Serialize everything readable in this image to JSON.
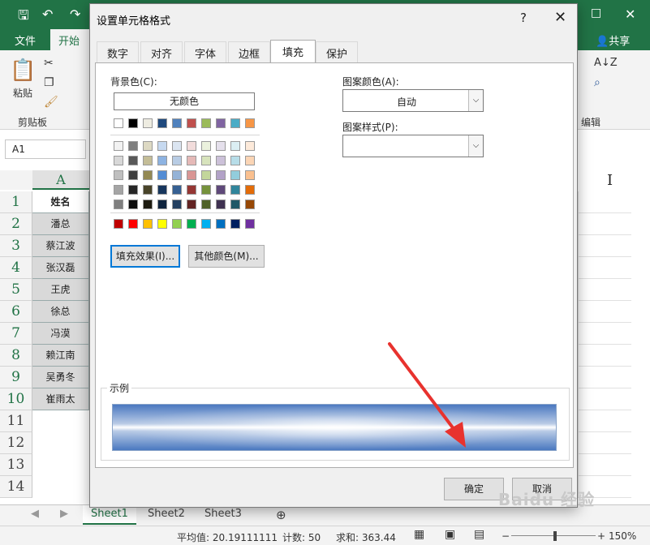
{
  "excel": {
    "ribbon_tabs": [
      "文件",
      "开始"
    ],
    "share_label": "共享",
    "clipboard": {
      "paste_label": "粘贴",
      "group_label": "剪贴板"
    },
    "edit_group_label": "编辑",
    "namebox_value": "A1",
    "column_a_label": "A",
    "col_i_label": "I",
    "rows": [
      "1",
      "2",
      "3",
      "4",
      "5",
      "6",
      "7",
      "8",
      "9",
      "10",
      "11",
      "12",
      "13",
      "14"
    ],
    "names": [
      "姓名",
      "潘总",
      "蔡江波",
      "张汉磊",
      "王虎",
      "徐总",
      "冯漠",
      "赖江南",
      "吴勇冬",
      "崔雨太"
    ],
    "sheets": [
      "Sheet1",
      "Sheet2",
      "Sheet3"
    ],
    "status": {
      "average": "平均值: 20.19111111",
      "count": "计数: 50",
      "sum": "求和: 363.44",
      "zoom": "150%"
    }
  },
  "dialog": {
    "title": "设置单元格格式",
    "help": "?",
    "tabs": [
      "数字",
      "对齐",
      "字体",
      "边框",
      "填充",
      "保护"
    ],
    "active_tab": "填充",
    "background_color_label": "背景色(C):",
    "no_color_label": "无颜色",
    "pattern_color_label": "图案颜色(A):",
    "pattern_color_value": "自动",
    "pattern_style_label": "图案样式(P):",
    "pattern_style_value": "",
    "fill_effects_button": "填充效果(I)...",
    "more_colors_button": "其他颜色(M)...",
    "sample_label": "示例",
    "ok_button": "确定",
    "cancel_button": "取消",
    "palette": {
      "theme_top": [
        "#ffffff",
        "#000000",
        "#eeece1",
        "#1f497d",
        "#4f81bd",
        "#c0504d",
        "#9bbb59",
        "#8064a2",
        "#4bacc6",
        "#f79646"
      ],
      "theme_shades": [
        [
          "#f2f2f2",
          "#7f7f7f",
          "#ddd9c3",
          "#c6d9f0",
          "#dbe5f1",
          "#f2dcdb",
          "#ebf1dd",
          "#e5e0ec",
          "#dbeef3",
          "#fdeada"
        ],
        [
          "#d8d8d8",
          "#595959",
          "#c4bd97",
          "#8db3e2",
          "#b8cce4",
          "#e5b9b7",
          "#d7e3bc",
          "#ccc1d9",
          "#b7dde8",
          "#fbd5b5"
        ],
        [
          "#bfbfbf",
          "#3f3f3f",
          "#938953",
          "#548dd4",
          "#95b3d7",
          "#d99694",
          "#c3d69b",
          "#b2a2c7",
          "#92cddc",
          "#fac08f"
        ],
        [
          "#a5a5a5",
          "#262626",
          "#494429",
          "#17365d",
          "#366092",
          "#953734",
          "#76923c",
          "#5f497a",
          "#31859b",
          "#e36c09"
        ],
        [
          "#7f7f7f",
          "#0c0c0c",
          "#1d1b10",
          "#0f243e",
          "#244061",
          "#632423",
          "#4f6128",
          "#3f3151",
          "#205867",
          "#974806"
        ]
      ],
      "standard": [
        "#c00000",
        "#ff0000",
        "#ffc000",
        "#ffff00",
        "#92d050",
        "#00b050",
        "#00b0f0",
        "#0070c0",
        "#002060",
        "#7030a0"
      ]
    }
  },
  "watermark": "Baidu 经验"
}
